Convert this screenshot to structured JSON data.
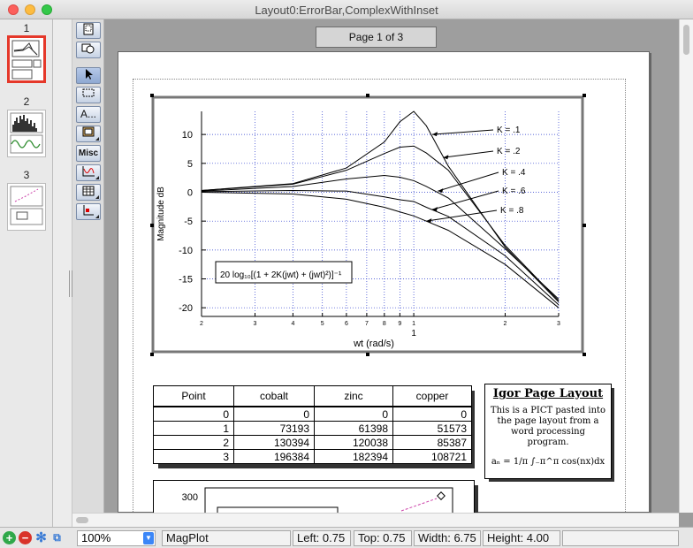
{
  "window": {
    "title": "Layout0:ErrorBar,ComplexWithInset"
  },
  "pages": [
    {
      "num": "1"
    },
    {
      "num": "2"
    },
    {
      "num": "3"
    }
  ],
  "page_indicator": "Page 1 of 3",
  "tools": {
    "text_label": "A...",
    "misc_label": "Misc"
  },
  "chart_data": {
    "type": "line",
    "xlabel": "wt (rad/s)",
    "ylabel": "Magnitude dB",
    "x_scale": "log",
    "xlim": [
      0.2,
      3
    ],
    "ylim": [
      -21.5,
      14
    ],
    "x_tick_labels": [
      "2",
      "3",
      "4",
      "5",
      "6",
      "7",
      "8",
      "9",
      "1",
      "2",
      "3"
    ],
    "x_major_label": "1",
    "y_ticks": [
      10,
      5,
      0,
      -5,
      -10,
      -15,
      -20
    ],
    "grid": true,
    "formula_annotation": "20 log₁₀[(1 + 2K(jwt) + (jwt)²)]⁻¹",
    "series": [
      {
        "name": "K = .1",
        "x": [
          0.2,
          0.4,
          0.6,
          0.8,
          0.9,
          1.0,
          1.1,
          1.3,
          2.0,
          3.0
        ],
        "y": [
          0.3,
          1.5,
          4.2,
          8.7,
          12.2,
          14.0,
          11.5,
          4.5,
          -9.5,
          -19.0
        ]
      },
      {
        "name": "K = .2",
        "x": [
          0.2,
          0.4,
          0.6,
          0.8,
          0.9,
          1.0,
          1.1,
          1.3,
          2.0,
          3.0
        ],
        "y": [
          0.3,
          1.4,
          3.8,
          6.7,
          7.8,
          8.0,
          6.8,
          3.8,
          -9.2,
          -18.8
        ]
      },
      {
        "name": "K = .4",
        "x": [
          0.2,
          0.4,
          0.6,
          0.8,
          0.9,
          1.0,
          1.1,
          1.3,
          2.0,
          3.0
        ],
        "y": [
          0.2,
          1.0,
          2.3,
          2.9,
          2.6,
          2.0,
          1.0,
          -1.0,
          -9.8,
          -18.5
        ]
      },
      {
        "name": "K = .6",
        "x": [
          0.2,
          0.4,
          0.6,
          0.8,
          0.9,
          1.0,
          1.1,
          1.3,
          2.0,
          3.0
        ],
        "y": [
          0.1,
          0.3,
          0.2,
          -0.8,
          -1.3,
          -1.6,
          -2.6,
          -4.2,
          -11.0,
          -19.5
        ]
      },
      {
        "name": "K = .8",
        "x": [
          0.2,
          0.4,
          0.6,
          0.8,
          0.9,
          1.0,
          1.1,
          1.3,
          2.0,
          3.0
        ],
        "y": [
          0.0,
          -0.3,
          -1.2,
          -2.6,
          -3.4,
          -4.1,
          -5.0,
          -6.6,
          -12.5,
          -20.0
        ]
      }
    ]
  },
  "table": {
    "headers": [
      "Point",
      "cobalt",
      "zinc",
      "copper"
    ],
    "rows": [
      [
        "0",
        "0",
        "0",
        "0"
      ],
      [
        "1",
        "73193",
        "61398",
        "51573"
      ],
      [
        "2",
        "130394",
        "120038",
        "85387"
      ],
      [
        "3",
        "196384",
        "182394",
        "108721"
      ]
    ]
  },
  "notebox": {
    "title": "Igor Page Layout",
    "body": "This is a PICT pasted into the page layout from a word processing program.",
    "formula": "aₙ = 1/π ∫₋π^π cos(nx)dx"
  },
  "graph2": {
    "y_label": "300"
  },
  "status": {
    "zoom": "100%",
    "object": "MagPlot",
    "left": "Left: 0.75",
    "top": "Top: 0.75",
    "width": "Width: 6.75",
    "height": "Height: 4.00"
  },
  "colors": {
    "selected_page": "#e5382a",
    "grid": "#2233cc",
    "accent": "#3b86f7"
  }
}
